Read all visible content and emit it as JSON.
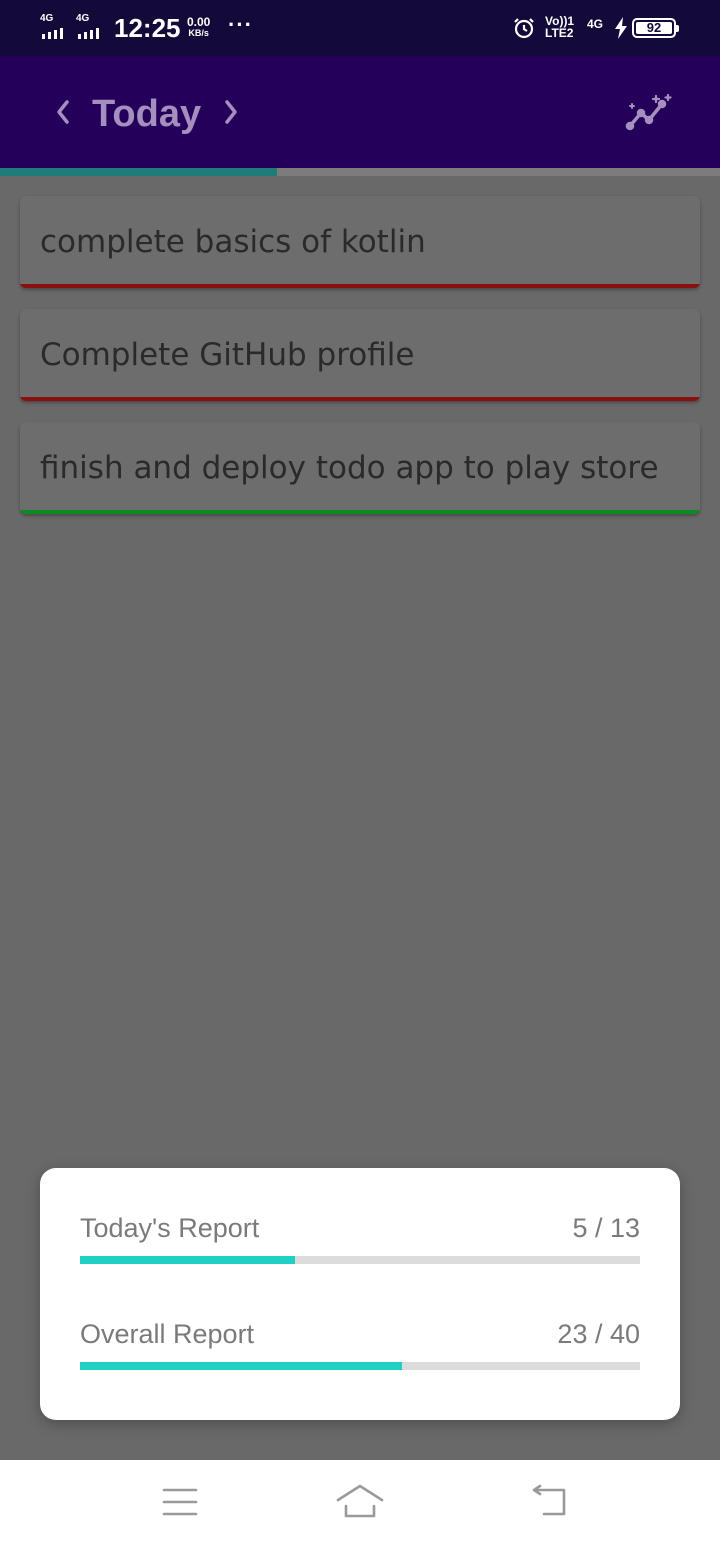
{
  "status_bar": {
    "sim1_network": "4G",
    "sim2_network": "4G",
    "time": "12:25",
    "data_speed": "0.00",
    "data_speed_unit": "KB/s",
    "more_indicator": "···",
    "volte_label": "Vo))1",
    "lte_label": "LTE2",
    "network2_label": "4G",
    "battery_level": "92"
  },
  "app_bar": {
    "title": "Today",
    "prev_icon": "chevron-left-icon",
    "next_icon": "chevron-right-icon",
    "insights_icon": "insights-icon",
    "background": "#24005a"
  },
  "day_progress": {
    "fraction": 0.385,
    "color": "#207c76"
  },
  "tasks": [
    {
      "title": "complete basics of kotlin",
      "status_color": "#8a0f0f"
    },
    {
      "title": "Complete GitHub profile",
      "status_color": "#8a0f0f"
    },
    {
      "title": "finish and deploy todo app to play store",
      "status_color": "#0f8a1e"
    }
  ],
  "report": {
    "today": {
      "label": "Today's Report",
      "done": 5,
      "total": 13,
      "count_text": "5 / 13"
    },
    "overall": {
      "label": "Overall Report",
      "done": 23,
      "total": 40,
      "count_text": "23 / 40"
    },
    "bar_color": "#1ed1c2"
  },
  "system_nav": {
    "menu_icon": "menu-icon",
    "home_icon": "home-icon",
    "back_icon": "back-icon"
  }
}
